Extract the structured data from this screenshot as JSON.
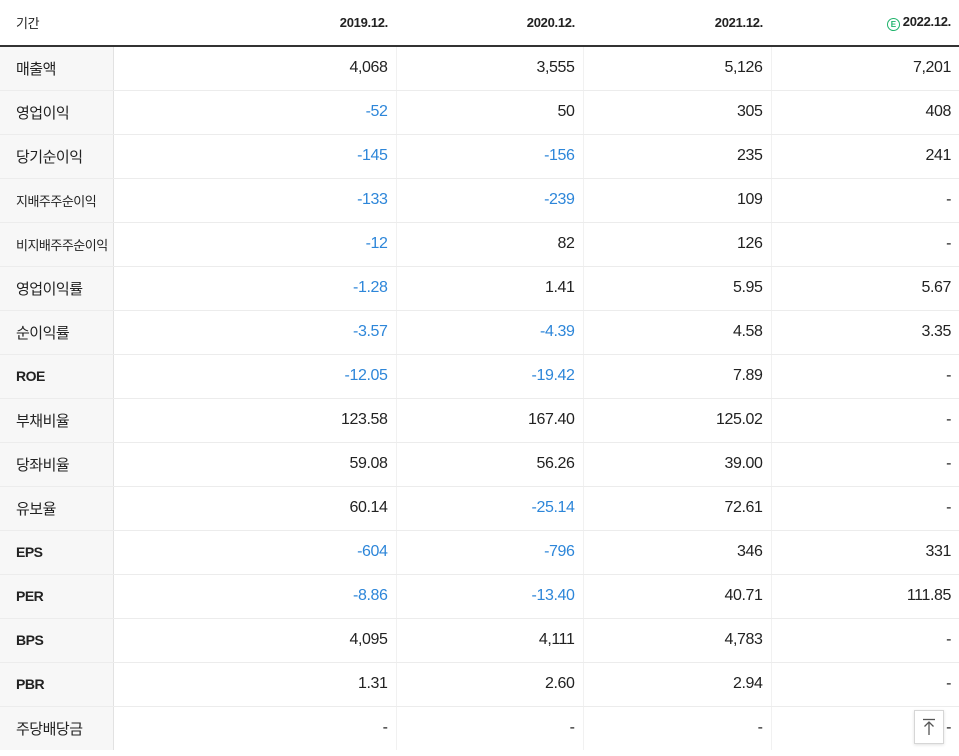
{
  "header": {
    "label": "기간",
    "periods": [
      "2019.12.",
      "2020.12.",
      "2021.12.",
      "2022.12."
    ],
    "estimate_icon_text": "E",
    "estimate_color": "#1fb36b"
  },
  "colors": {
    "negative": "#2d86d9",
    "text": "#222222",
    "label_bg": "#f7f7f7"
  },
  "rows": [
    {
      "label": "매출액",
      "values": [
        "4,068",
        "3,555",
        "5,126",
        "7,201"
      ]
    },
    {
      "label": "영업이익",
      "values": [
        "-52",
        "50",
        "305",
        "408"
      ]
    },
    {
      "label": "당기순이익",
      "values": [
        "-145",
        "-156",
        "235",
        "241"
      ]
    },
    {
      "label": "지배주주순이익",
      "values": [
        "-133",
        "-239",
        "109",
        "-"
      ]
    },
    {
      "label": "비지배주주순이익",
      "values": [
        "-12",
        "82",
        "126",
        "-"
      ]
    },
    {
      "label": "영업이익률",
      "values": [
        "-1.28",
        "1.41",
        "5.95",
        "5.67"
      ]
    },
    {
      "label": "순이익률",
      "values": [
        "-3.57",
        "-4.39",
        "4.58",
        "3.35"
      ]
    },
    {
      "label": "ROE",
      "values": [
        "-12.05",
        "-19.42",
        "7.89",
        "-"
      ]
    },
    {
      "label": "부채비율",
      "values": [
        "123.58",
        "167.40",
        "125.02",
        "-"
      ]
    },
    {
      "label": "당좌비율",
      "values": [
        "59.08",
        "56.26",
        "39.00",
        "-"
      ]
    },
    {
      "label": "유보율",
      "values": [
        "60.14",
        "-25.14",
        "72.61",
        "-"
      ]
    },
    {
      "label": "EPS",
      "values": [
        "-604",
        "-796",
        "346",
        "331"
      ]
    },
    {
      "label": "PER",
      "values": [
        "-8.86",
        "-13.40",
        "40.71",
        "111.85"
      ]
    },
    {
      "label": "BPS",
      "values": [
        "4,095",
        "4,111",
        "4,783",
        "-"
      ]
    },
    {
      "label": "PBR",
      "values": [
        "1.31",
        "2.60",
        "2.94",
        "-"
      ]
    },
    {
      "label": "주당배당금",
      "values": [
        "-",
        "-",
        "-",
        "-"
      ]
    }
  ],
  "scroll_top_icon": "arrow-up-to-top-icon"
}
